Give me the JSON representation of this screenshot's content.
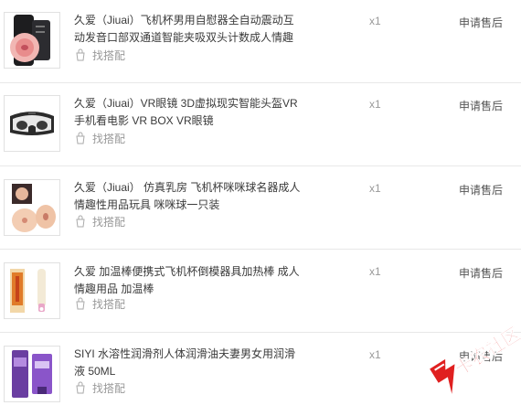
{
  "orders": [
    {
      "title": "久爱（Jiuai）飞机杯男用自慰器全自动震动互动发音口部双通道智能夹吸双头计数成人情趣",
      "match_label": "找搭配",
      "quantity": "x1",
      "after_sale": "申请售后",
      "thumb_icon": "masturbator-cup-icon"
    },
    {
      "title": "久爱（Jiuai）VR眼镜 3D虚拟现实智能头盔VR手机看电影 VR BOX VR眼镜",
      "match_label": "找搭配",
      "quantity": "x1",
      "after_sale": "申请售后",
      "thumb_icon": "vr-headset-icon"
    },
    {
      "title": "久爱（Jiuai） 仿真乳房 飞机杯咪咪球名器成人情趣性用品玩具 咪咪球一只装",
      "match_label": "找搭配",
      "quantity": "x1",
      "after_sale": "申请售后",
      "thumb_icon": "toy-product-icon"
    },
    {
      "title": "久爱 加温棒便携式飞机杯倒模器具加热棒 成人情趣用品 加温棒",
      "match_label": "找搭配",
      "quantity": "x1",
      "after_sale": "申请售后",
      "thumb_icon": "heating-rod-icon"
    },
    {
      "title": "SIYI 水溶性润滑剂人体润滑油夫妻男女用润滑液 50ML",
      "match_label": "找搭配",
      "quantity": "x1",
      "after_sale": "申请售后",
      "thumb_icon": "lubricant-tube-icon"
    }
  ],
  "watermark": {
    "text": "卡农社区",
    "color": "#e02020"
  }
}
